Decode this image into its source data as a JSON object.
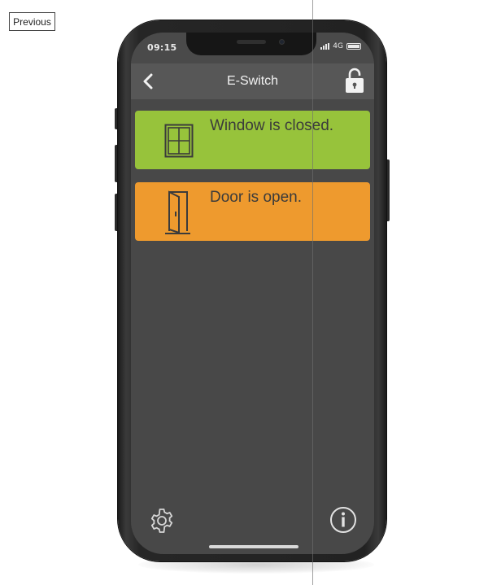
{
  "page": {
    "previous_button_label": "Previous"
  },
  "status_bar": {
    "time": "09:15",
    "network": "4G"
  },
  "app": {
    "title": "E-Switch",
    "header_icons": {
      "back": "chevron-left-icon",
      "lock": "lock-open-icon"
    }
  },
  "cards": [
    {
      "text": "Window is closed.",
      "icon": "window-icon",
      "state_color": "#97c33b"
    },
    {
      "text": "Door is open.",
      "icon": "door-icon",
      "state_color": "#ee9a2e"
    }
  ],
  "bottom_bar": {
    "left_icon": "gear-icon",
    "right_icon": "info-icon"
  },
  "colors": {
    "screen_bg": "#484848",
    "header_bg": "#575757",
    "window_closed": "#97c33b",
    "door_open": "#ee9a2e"
  }
}
